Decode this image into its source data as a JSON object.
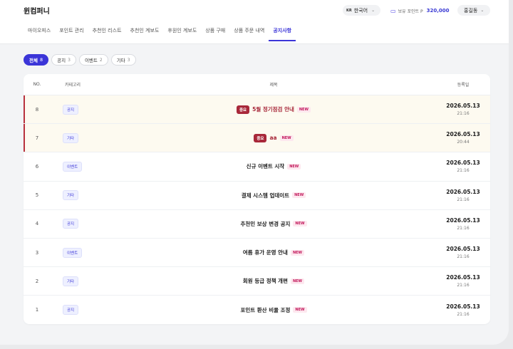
{
  "header": {
    "brand": "윈컴퍼니",
    "lang_code": "KR",
    "lang_label": "한국어",
    "points_label": "보유 포인트 P",
    "points_value": "320,000",
    "user_name": "홍길동"
  },
  "nav": [
    {
      "label": "마이오피스",
      "active": false
    },
    {
      "label": "포인트 관리",
      "active": false
    },
    {
      "label": "추천인 리스트",
      "active": false
    },
    {
      "label": "추천인 계보도",
      "active": false
    },
    {
      "label": "후원인 계보도",
      "active": false
    },
    {
      "label": "상품 구매",
      "active": false
    },
    {
      "label": "상품 주문 내역",
      "active": false
    },
    {
      "label": "공지사항",
      "active": true
    }
  ],
  "filters": [
    {
      "label": "전체",
      "count": "8",
      "active": true
    },
    {
      "label": "공지",
      "count": "3",
      "active": false
    },
    {
      "label": "이벤트",
      "count": "2",
      "active": false
    },
    {
      "label": "기타",
      "count": "3",
      "active": false
    }
  ],
  "table": {
    "columns": {
      "no": "NO.",
      "category": "카테고리",
      "title": "제목",
      "date": "등록일"
    },
    "rows": [
      {
        "no": "8",
        "category": "공지",
        "important": "중요",
        "title": "5월 정기점검 안내",
        "new": "NEW",
        "date": "2026.05.13",
        "time": "21:16",
        "pinned": true
      },
      {
        "no": "7",
        "category": "기타",
        "important": "중요",
        "title": "aa",
        "new": "NEW",
        "date": "2026.05.13",
        "time": "20:44",
        "pinned": true
      },
      {
        "no": "6",
        "category": "이벤트",
        "important": "",
        "title": "신규 이벤트 시작",
        "new": "NEW",
        "date": "2026.05.13",
        "time": "21:16",
        "pinned": false
      },
      {
        "no": "5",
        "category": "기타",
        "important": "",
        "title": "결제 시스템 업데이트",
        "new": "NEW",
        "date": "2026.05.13",
        "time": "21:16",
        "pinned": false
      },
      {
        "no": "4",
        "category": "공지",
        "important": "",
        "title": "추천인 보상 변경 공지",
        "new": "NEW",
        "date": "2026.05.13",
        "time": "21:16",
        "pinned": false
      },
      {
        "no": "3",
        "category": "이벤트",
        "important": "",
        "title": "여름 휴가 운영 안내",
        "new": "NEW",
        "date": "2026.05.13",
        "time": "21:16",
        "pinned": false
      },
      {
        "no": "2",
        "category": "기타",
        "important": "",
        "title": "회원 등급 정책 개편",
        "new": "NEW",
        "date": "2026.05.13",
        "time": "21:16",
        "pinned": false
      },
      {
        "no": "1",
        "category": "공지",
        "important": "",
        "title": "포인트 환산 비율 조정",
        "new": "NEW",
        "date": "2026.05.13",
        "time": "21:16",
        "pinned": false
      }
    ]
  },
  "colors": {
    "accent": "#3b35d8",
    "important": "#a8283a",
    "pinned_bg": "#fdfaf0"
  }
}
